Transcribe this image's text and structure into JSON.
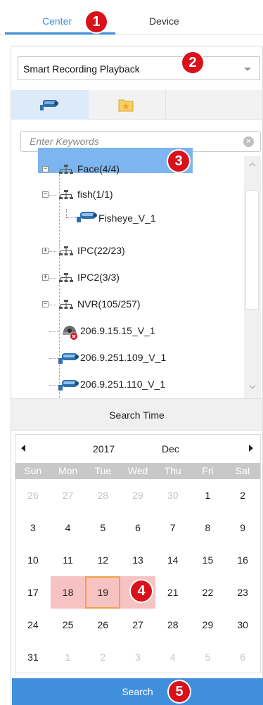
{
  "tabs": {
    "center": "Center",
    "device": "Device"
  },
  "mode_select": {
    "value": "Smart Recording Playback"
  },
  "icon_tabs": {
    "camera": "camera-icon",
    "favorites": "favorites-folder-icon"
  },
  "search": {
    "placeholder": "Enter Keywords"
  },
  "tree": {
    "nodes": [
      {
        "label": "Face(4/4)",
        "type": "org"
      },
      {
        "label": "fish(1/1)",
        "type": "org"
      },
      {
        "label": "Fisheye_V_1",
        "type": "camera",
        "selected": true
      },
      {
        "label": "IPC(22/23)",
        "type": "org"
      },
      {
        "label": "IPC2(3/3)",
        "type": "org"
      },
      {
        "label": "NVR(105/257)",
        "type": "org"
      },
      {
        "label": "206.9.15.15_V_1",
        "type": "camera-offline"
      },
      {
        "label": "206.9.251.109_V_1",
        "type": "camera"
      },
      {
        "label": "206.9.251.110_V_1",
        "type": "camera"
      }
    ]
  },
  "search_time": {
    "label": "Search Time"
  },
  "calendar": {
    "year": "2017",
    "month": "Dec",
    "weekdays": [
      "Sun",
      "Mon",
      "Tue",
      "Wed",
      "Thu",
      "Fri",
      "Sat"
    ],
    "weeks": [
      [
        "26",
        "27",
        "28",
        "29",
        "30",
        "1",
        "2"
      ],
      [
        "3",
        "4",
        "5",
        "6",
        "7",
        "8",
        "9"
      ],
      [
        "10",
        "11",
        "12",
        "13",
        "14",
        "15",
        "16"
      ],
      [
        "17",
        "18",
        "19",
        "20",
        "21",
        "22",
        "23"
      ],
      [
        "24",
        "25",
        "26",
        "27",
        "28",
        "29",
        "30"
      ],
      [
        "31",
        "1",
        "2",
        "3",
        "4",
        "5",
        "6"
      ]
    ],
    "selected_day": "19",
    "highlighted_days": [
      "18",
      "19",
      "20"
    ]
  },
  "search_button": {
    "label": "Search"
  },
  "callouts": [
    "1",
    "2",
    "3",
    "4",
    "5"
  ],
  "colors": {
    "accent": "#3f8fdc",
    "selection": "#7db5f0",
    "highlight": "#f7c2c2",
    "today_border": "#f1a344",
    "badge": "#d9111b"
  }
}
